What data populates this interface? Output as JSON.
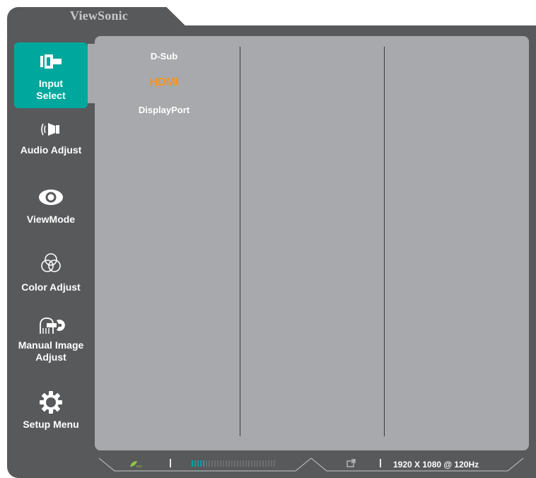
{
  "brand": "ViewSonic",
  "colors": {
    "frame": "#58595b",
    "panel": "#a7a9ac",
    "active": "#00a79d",
    "selected_option": "#f7941d"
  },
  "sidebar": {
    "items": [
      {
        "label": "Input Select",
        "icon": "input-select-icon",
        "active": true
      },
      {
        "label": "Audio Adjust",
        "icon": "speaker-icon",
        "active": false
      },
      {
        "label": "ViewMode",
        "icon": "eye-icon",
        "active": false
      },
      {
        "label": "Color Adjust",
        "icon": "rgb-circles-icon",
        "active": false
      },
      {
        "label": "Manual Image Adjust",
        "icon": "hand-wrench-icon",
        "active": false
      },
      {
        "label": "Setup Menu",
        "icon": "gear-icon",
        "active": false
      }
    ]
  },
  "input_options": {
    "items": [
      "D-Sub",
      "HDMI",
      "DisplayPort"
    ],
    "selected": "HDMI"
  },
  "status_bar": {
    "eco_icon": "eco-leaf-icon",
    "signal_icon": "input-signal-icon",
    "resolution": "1920 X 1080 @ 120Hz",
    "level_bar_fraction": 0.17
  }
}
